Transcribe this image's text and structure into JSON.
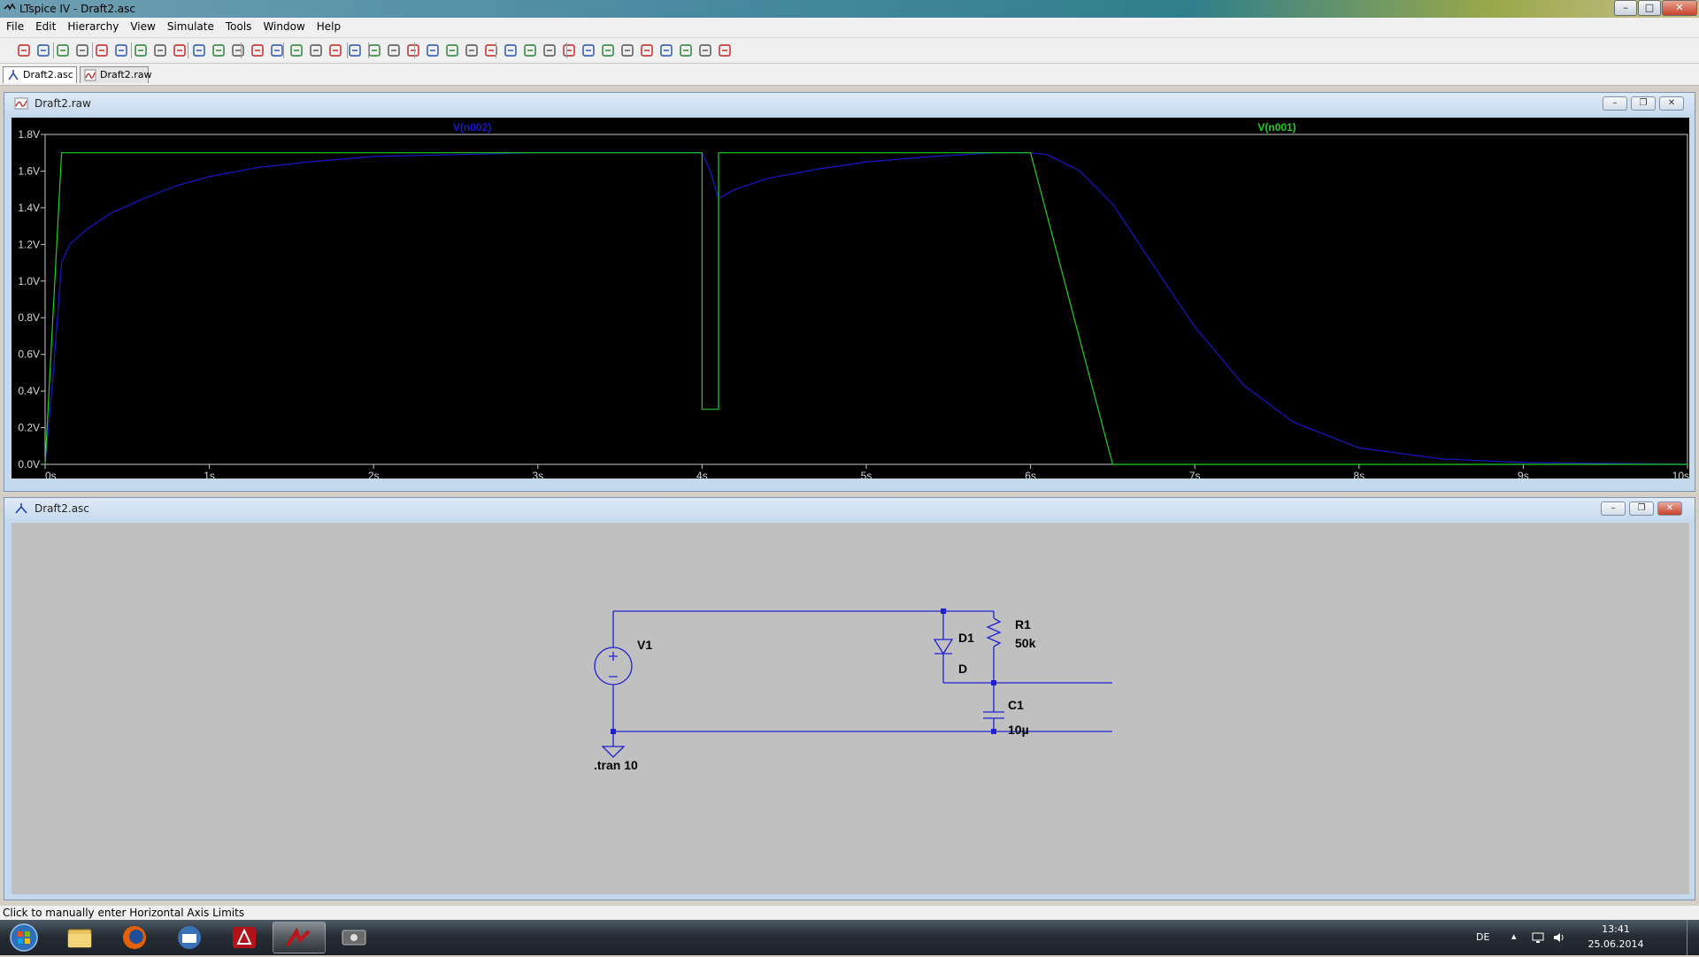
{
  "window": {
    "title": "LTspice IV - Draft2.asc",
    "buttons": [
      "–",
      "□",
      "✕"
    ]
  },
  "menu": [
    "File",
    "Edit",
    "Hierarchy",
    "View",
    "Simulate",
    "Tools",
    "Window",
    "Help"
  ],
  "toolbar_icons": [
    "new-schematic-icon",
    "open-icon",
    "save-icon",
    "control-panel-icon",
    "run-icon",
    "halt-icon",
    "zoom-in-icon",
    "zoom-pan-icon",
    "zoom-out-icon",
    "zoom-fit-icon",
    "autorange-icon",
    "grid-icon",
    "tile-horizontal-icon",
    "cascade-icon",
    "tile-vertical-icon",
    "cut-icon",
    "copy-icon",
    "paste-icon",
    "find-icon",
    "print-setup-icon",
    "print-icon",
    "wire-icon",
    "ground-icon",
    "label-net-icon",
    "resistor-icon",
    "capacitor-icon",
    "inductor-icon",
    "diode-icon",
    "component-icon",
    "move-icon",
    "drag-icon",
    "undo-icon",
    "redo-icon",
    "rotate-icon",
    "mirror-icon",
    "text-icon",
    "spice-directive-icon"
  ],
  "tabs": [
    {
      "label": "Draft2.asc",
      "icon": "schematic-icon"
    },
    {
      "label": "Draft2.raw",
      "icon": "waveform-icon"
    }
  ],
  "waveform_window": {
    "title": "Draft2.raw"
  },
  "schematic_window": {
    "title": "Draft2.asc"
  },
  "chart_data": {
    "type": "line",
    "title": "",
    "xlabel": "",
    "ylabel": "",
    "xlim": [
      0,
      10
    ],
    "ylim": [
      0,
      1.8
    ],
    "x_ticks": [
      "0s",
      "1s",
      "2s",
      "3s",
      "4s",
      "5s",
      "6s",
      "7s",
      "8s",
      "9s",
      "10s"
    ],
    "y_ticks": [
      "0.0V",
      "0.2V",
      "0.4V",
      "0.6V",
      "0.8V",
      "1.0V",
      "1.2V",
      "1.4V",
      "1.6V",
      "1.8V"
    ],
    "grid": false,
    "background": "#000000",
    "series": [
      {
        "name": "V(n002)",
        "color": "#1818d0",
        "x": [
          0,
          0.05,
          0.1,
          0.15,
          0.25,
          0.4,
          0.6,
          0.8,
          1.0,
          1.3,
          1.6,
          2.0,
          2.5,
          3.0,
          3.5,
          4.0,
          4.05,
          4.1,
          4.2,
          4.4,
          4.7,
          5.0,
          5.4,
          5.8,
          6.0,
          6.1,
          6.3,
          6.5,
          6.7,
          7.0,
          7.3,
          7.6,
          8.0,
          8.5,
          9.0,
          9.5,
          10.0
        ],
        "y": [
          0,
          0.5,
          1.1,
          1.2,
          1.28,
          1.37,
          1.45,
          1.52,
          1.57,
          1.62,
          1.65,
          1.68,
          1.69,
          1.7,
          1.7,
          1.7,
          1.6,
          1.45,
          1.5,
          1.56,
          1.61,
          1.65,
          1.68,
          1.7,
          1.7,
          1.69,
          1.6,
          1.42,
          1.15,
          0.75,
          0.43,
          0.23,
          0.09,
          0.03,
          0.01,
          0.005,
          0.0
        ]
      },
      {
        "name": "V(n001)",
        "color": "#20d020",
        "x": [
          0,
          0.1,
          4.0,
          4.0,
          4.1,
          4.1,
          6.0,
          6.5,
          10.0
        ],
        "y": [
          0,
          1.7,
          1.7,
          0.3,
          0.3,
          1.7,
          1.7,
          0,
          0
        ]
      }
    ]
  },
  "schematic": {
    "labels": {
      "v1": "V1",
      "d1": "D1",
      "d1_model": "D",
      "r1": "R1",
      "r1_value": "50k",
      "c1": "C1",
      "c1_value": "10µ",
      "directive": ".tran 10"
    },
    "wire_color": "#2020d0"
  },
  "status_bar": {
    "text": "Click to manually enter Horizontal Axis Limits"
  },
  "taskbar": {
    "apps": [
      "start-orb-icon",
      "explorer-icon",
      "firefox-icon",
      "thunderbird-icon",
      "acrobat-icon",
      "ltspice-icon",
      "media-icon"
    ],
    "active_app": "ltspice-icon",
    "tray": {
      "language": "DE",
      "time": "13:41",
      "date": "25.06.2014"
    }
  }
}
